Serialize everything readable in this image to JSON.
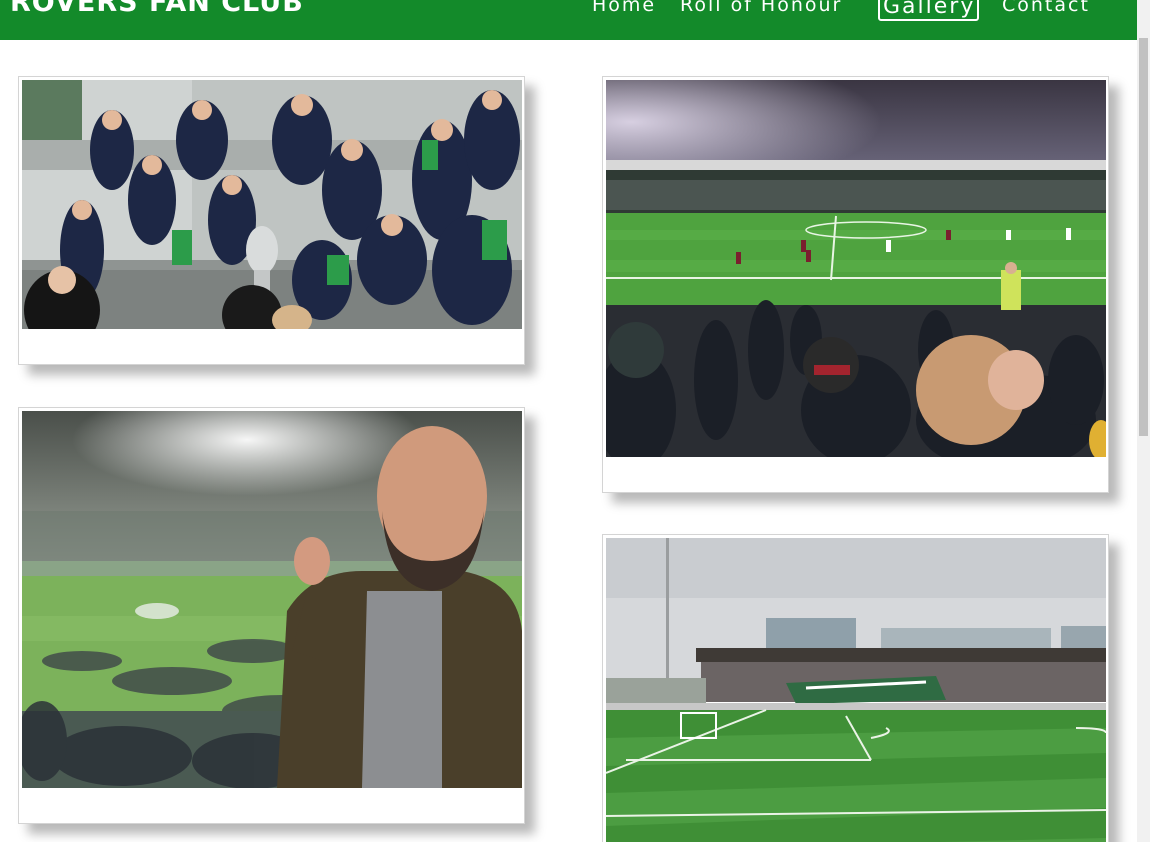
{
  "header": {
    "site_title": "ROVERS FAN CLUB",
    "nav": {
      "home": "Home",
      "roll_of_honour": "Roll of Honour",
      "gallery": "Gallery",
      "contact": "Contact"
    },
    "active_nav": "gallery"
  },
  "colors": {
    "header_bg": "#138a2a",
    "nav_text": "#ffffff",
    "page_bg": "#ffffff"
  },
  "gallery": {
    "photos": [
      {
        "subject": "players celebrating with trophy"
      },
      {
        "subject": "night match viewed from stand"
      },
      {
        "subject": "fan fist pump in stadium"
      },
      {
        "subject": "daytime stadium with banner"
      }
    ]
  }
}
